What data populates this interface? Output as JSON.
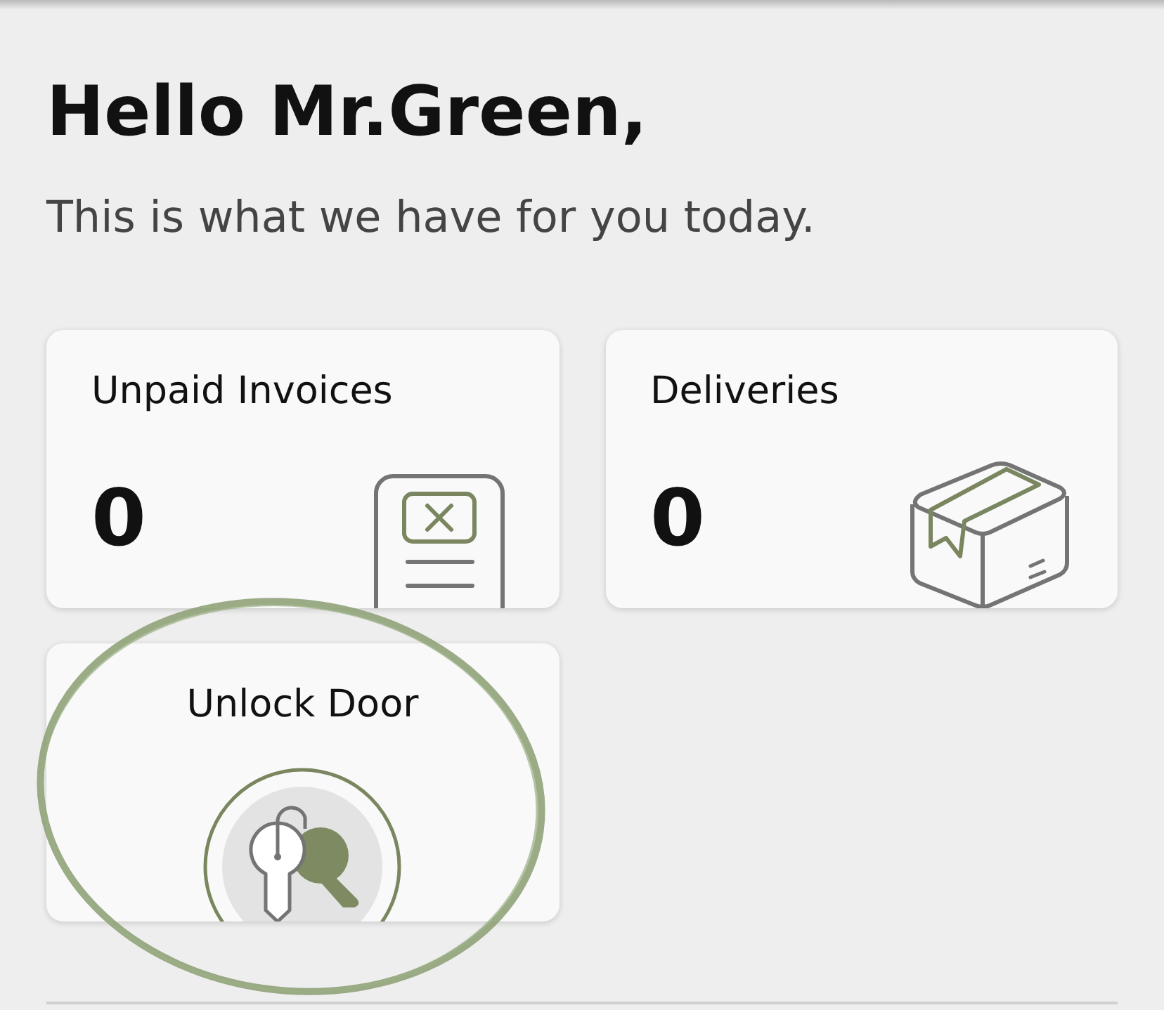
{
  "greeting": {
    "title": "Hello Mr.Green,",
    "subtitle": "This is what we have for you today."
  },
  "cards": [
    {
      "kind": "invoices",
      "title": "Unpaid Invoices",
      "count": "0",
      "highlighted": false
    },
    {
      "kind": "deliveries",
      "title": "Deliveries",
      "count": "0",
      "highlighted": false
    },
    {
      "kind": "unlock",
      "title": "Unlock Door",
      "highlighted": true
    }
  ]
}
